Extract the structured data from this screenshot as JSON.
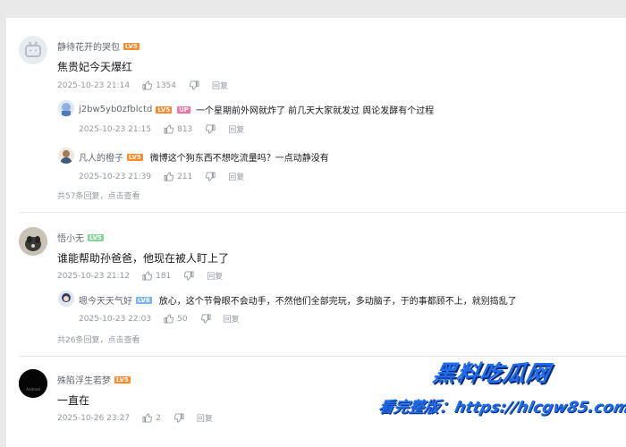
{
  "comments": [
    {
      "username": "静待花开的哭包",
      "level": "LV5",
      "text": "焦贵妃今天爆红",
      "time": "2025-10-23 21:14",
      "likes": "1354",
      "reply_label": "回复",
      "replies": [
        {
          "username": "j2bw5yb0zfblctd",
          "level": "LV5",
          "badge": "UP",
          "text": "一个星期前外网就炸了 前几天大家就发过 舆论发酵有个过程",
          "time": "2025-10-23 21:15",
          "likes": "813",
          "reply_label": "回复"
        },
        {
          "username": "凡人的橙子",
          "level": "LV5",
          "text": "微博这个狗东西不想吃流量吗？一点动静没有",
          "time": "2025-10-23 21:39",
          "likes": "211",
          "reply_label": "回复"
        }
      ],
      "more_replies": "共57条回复，点击查看"
    },
    {
      "username": "悟小无",
      "level": "LV5",
      "text": "谁能帮助孙爸爸，他现在被人盯上了",
      "time": "2025-10-23 21:12",
      "likes": "181",
      "reply_label": "回复",
      "replies": [
        {
          "username": "嗯今天天气好",
          "level": "LV6",
          "text": "放心，这个节骨眼不会动手，不然他们全部完玩，多动脑子，于的事都顾不上，就别捣乱了",
          "time": "2025-10-23 22:03",
          "likes": "50",
          "reply_label": "回复"
        }
      ],
      "more_replies": "共26条回复，点击查看"
    },
    {
      "username": "殊陷浮生若梦",
      "level": "LV5",
      "avatar_text": "Android",
      "text": "一直在",
      "time": "2025-10-26 23:27",
      "likes": "2",
      "reply_label": "回复"
    }
  ],
  "watermark": {
    "line1": "黑料吃瓜网",
    "line2": "看完整版：https://hlcgw85.com"
  },
  "colors": {
    "accent": "#1e6cf0",
    "meta": "#9499a0",
    "level_orange": "#ff8a2a",
    "level_pink": "#f56fa0"
  }
}
